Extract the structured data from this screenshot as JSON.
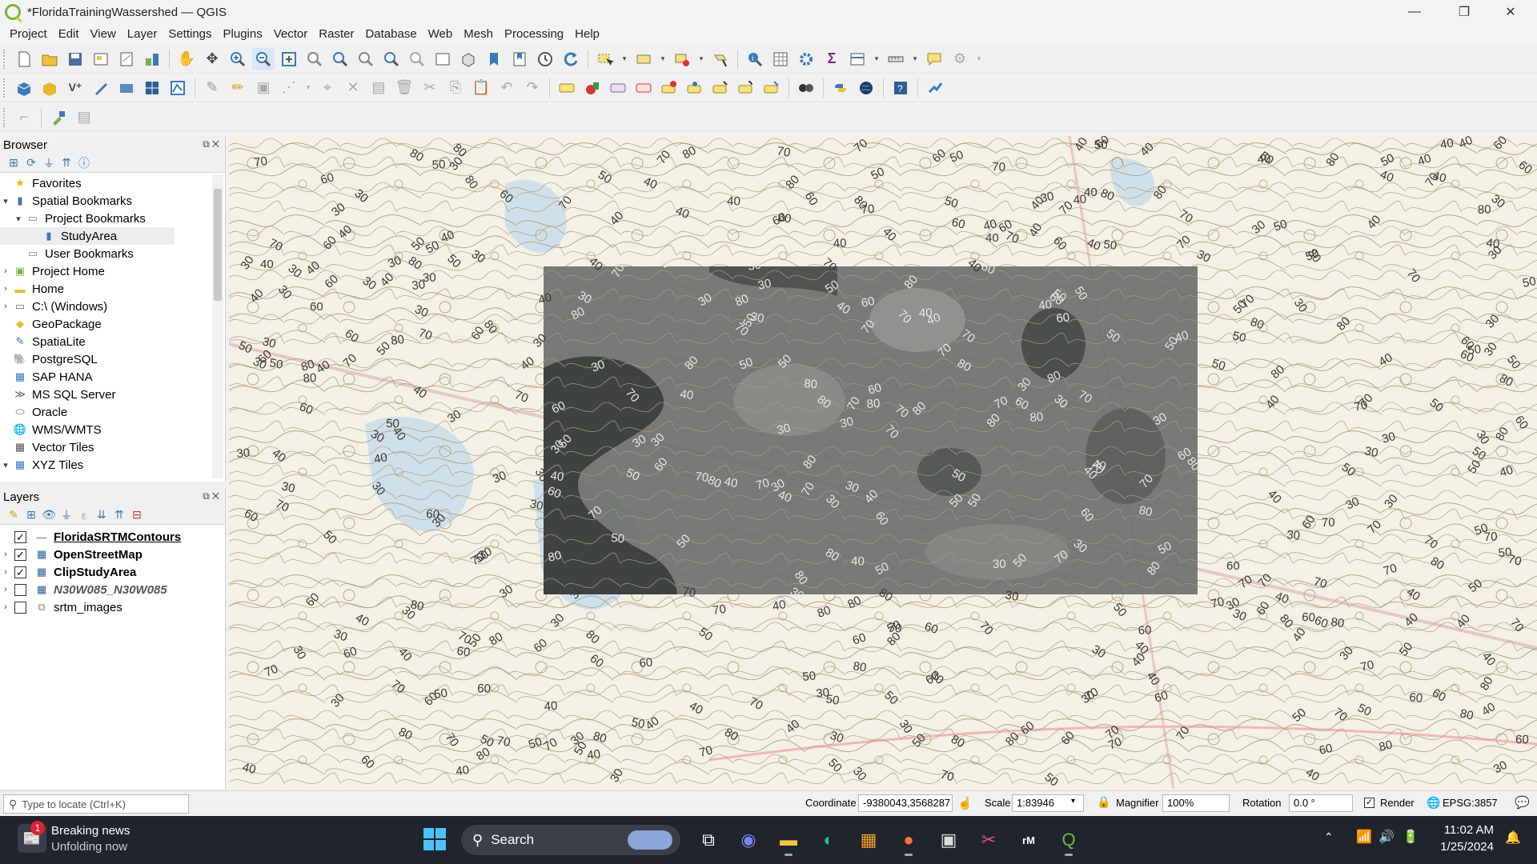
{
  "window": {
    "title": "*FloridaTrainingWassershed — QGIS",
    "minimize": "—",
    "restore": "❐",
    "close": "✕"
  },
  "menu": [
    "Project",
    "Edit",
    "View",
    "Layer",
    "Settings",
    "Plugins",
    "Vector",
    "Raster",
    "Database",
    "Web",
    "Mesh",
    "Processing",
    "Help"
  ],
  "browser": {
    "title": "Browser",
    "items": [
      {
        "label": "Favorites",
        "icon": "star-icon"
      },
      {
        "label": "Spatial Bookmarks",
        "icon": "bookmarks-icon"
      },
      {
        "label": "Project Bookmarks",
        "icon": "folder-icon"
      },
      {
        "label": "StudyArea",
        "icon": "bookmark-icon"
      },
      {
        "label": "User Bookmarks",
        "icon": "folder-icon"
      },
      {
        "label": "Project Home",
        "icon": "project-home-icon"
      },
      {
        "label": "Home",
        "icon": "folder-icon"
      },
      {
        "label": "C:\\ (Windows)",
        "icon": "drive-icon"
      },
      {
        "label": "GeoPackage",
        "icon": "geopackage-icon"
      },
      {
        "label": "SpatiaLite",
        "icon": "spatialite-icon"
      },
      {
        "label": "PostgreSQL",
        "icon": "postgresql-icon"
      },
      {
        "label": "SAP HANA",
        "icon": "sap-hana-icon"
      },
      {
        "label": "MS SQL Server",
        "icon": "mssql-icon"
      },
      {
        "label": "Oracle",
        "icon": "oracle-icon"
      },
      {
        "label": "WMS/WMTS",
        "icon": "wms-icon"
      },
      {
        "label": "Vector Tiles",
        "icon": "vector-tiles-icon"
      },
      {
        "label": "XYZ Tiles",
        "icon": "xyz-tiles-icon"
      }
    ]
  },
  "layers": {
    "title": "Layers",
    "items": [
      {
        "label": "FloridaSRTMContours",
        "checked": true
      },
      {
        "label": "OpenStreetMap",
        "checked": true
      },
      {
        "label": "ClipStudyArea",
        "checked": true
      },
      {
        "label": "N30W085_N30W085",
        "checked": false
      },
      {
        "label": "srtm_images",
        "checked": false
      }
    ]
  },
  "map": {
    "contour_labels": [
      "30",
      "40",
      "50",
      "60",
      "70",
      "80"
    ]
  },
  "statusbar": {
    "locate_placeholder": "Type to locate (Ctrl+K)",
    "coordinate_label": "Coordinate",
    "coordinate_value": "-9380043,3568287",
    "scale_label": "Scale",
    "scale_value": "1:83946",
    "magnifier_label": "Magnifier",
    "magnifier_value": "100%",
    "rotation_label": "Rotation",
    "rotation_value": "0.0 °",
    "render_label": "Render",
    "crs": "EPSG:3857"
  },
  "taskbar": {
    "news_title": "Breaking news",
    "news_subtitle": "Unfolding now",
    "news_badge": "1",
    "search_label": "Search",
    "time": "11:02 AM",
    "date": "1/25/2024"
  },
  "colors": {
    "accent": "#3a7ab8",
    "contour": "#a89a78",
    "clip_overlay": "#3c4240",
    "taskbar": "#20242c"
  }
}
